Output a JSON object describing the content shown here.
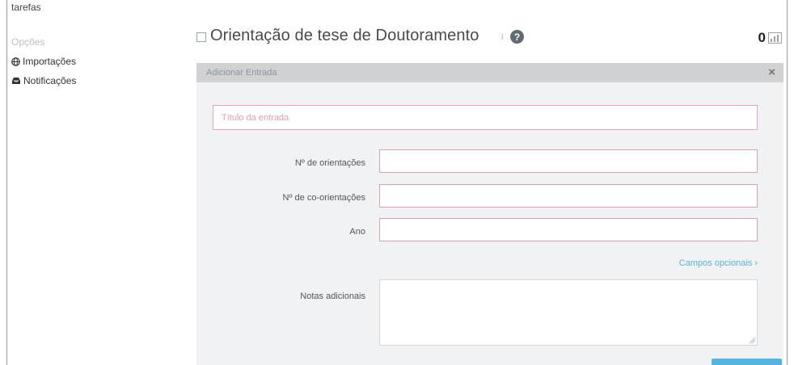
{
  "sidebar": {
    "top_label": "tarefas",
    "options_label": "Opções",
    "items": [
      {
        "label": "Importações",
        "icon": "globe-icon"
      },
      {
        "label": "Notificações",
        "icon": "inbox-icon"
      }
    ]
  },
  "header": {
    "title": "Orientação de tese de Doutoramento",
    "subtitle": "i",
    "help_glyph": "?",
    "count": "0",
    "chart_icon": "bar-chart-icon"
  },
  "panel": {
    "bar_title": "Adicionar Entrada",
    "close_glyph": "×",
    "title_placeholder": "Título da entrada",
    "fields": {
      "orientacoes_label": "Nº de orientações",
      "coorientacoes_label": "Nº de co-orientações",
      "ano_label": "Ano",
      "notas_label": "Notas adicionais"
    },
    "optional_link": "Campos opcionais ›"
  },
  "colors": {
    "accent": "#5ab1da",
    "error_border": "#d8a1ac",
    "panel_bg": "#f1f2f3",
    "panel_bar": "#cfd1d3"
  }
}
